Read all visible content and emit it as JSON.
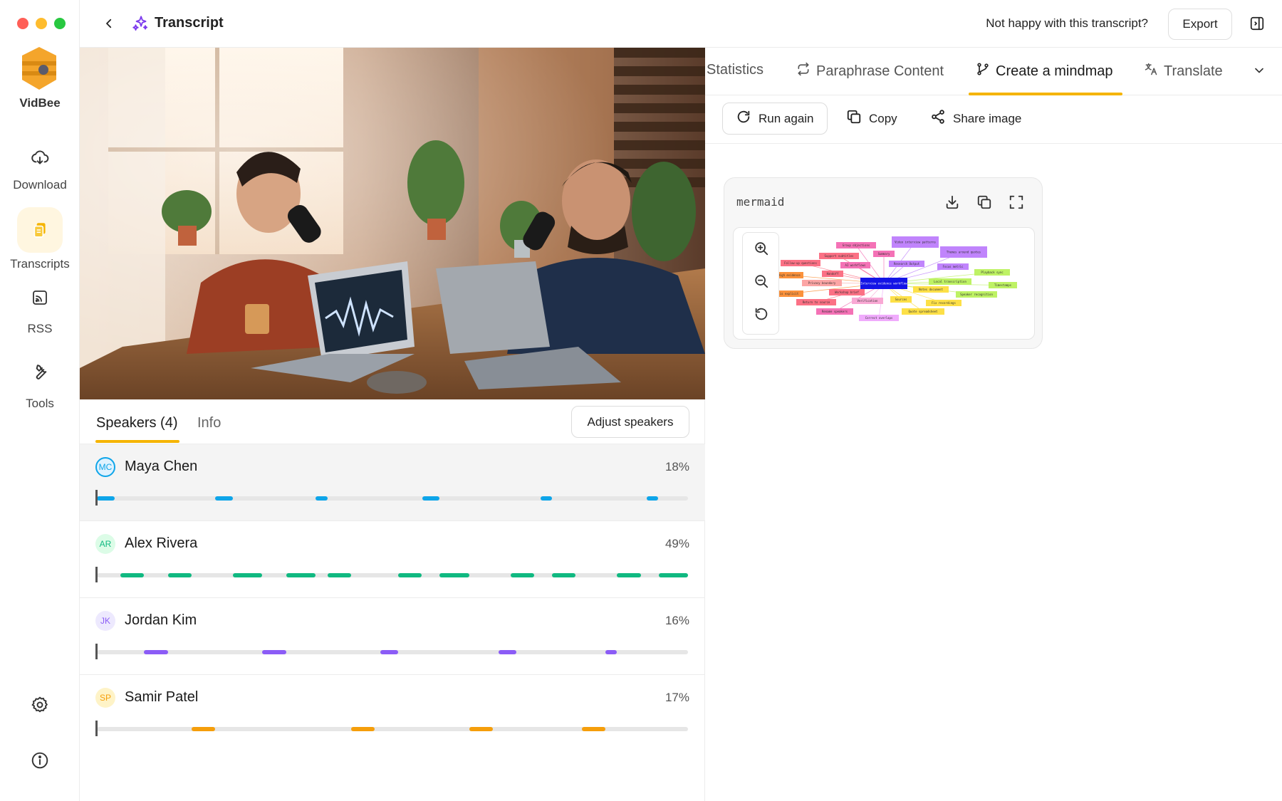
{
  "app": {
    "name": "VidBee",
    "traffic_colors": [
      "#ff5f57",
      "#febc2e",
      "#28c840"
    ]
  },
  "sidebar": {
    "items": [
      {
        "label": "Download",
        "icon": "cloud-download-icon"
      },
      {
        "label": "Transcripts",
        "icon": "document-copy-icon",
        "active": true
      },
      {
        "label": "RSS",
        "icon": "rss-icon"
      },
      {
        "label": "Tools",
        "icon": "wrench-icon"
      }
    ],
    "bottom": [
      {
        "icon": "gear-icon"
      },
      {
        "icon": "info-icon"
      }
    ]
  },
  "header": {
    "title": "Transcript",
    "feedback_text": "Not happy with this transcript?",
    "export_label": "Export"
  },
  "speakers_panel": {
    "tabs": [
      {
        "label": "Speakers (4)",
        "active": true
      },
      {
        "label": "Info",
        "active": false
      }
    ],
    "adjust_label": "Adjust speakers",
    "speakers": [
      {
        "initials": "MC",
        "name": "Maya Chen",
        "percent": "18%",
        "color": "#0ea5e9",
        "bg": "#e0f2fe",
        "selected": true,
        "segments": [
          [
            0.0,
            0.03
          ],
          [
            0.2,
            0.23
          ],
          [
            0.37,
            0.39
          ],
          [
            0.55,
            0.58
          ],
          [
            0.75,
            0.77
          ],
          [
            0.93,
            0.95
          ]
        ]
      },
      {
        "initials": "AR",
        "name": "Alex Rivera",
        "percent": "49%",
        "color": "#10b981",
        "bg": "#dcfce7",
        "selected": false,
        "segments": [
          [
            0.04,
            0.08
          ],
          [
            0.12,
            0.16
          ],
          [
            0.23,
            0.28
          ],
          [
            0.32,
            0.37
          ],
          [
            0.39,
            0.43
          ],
          [
            0.51,
            0.55
          ],
          [
            0.58,
            0.63
          ],
          [
            0.7,
            0.74
          ],
          [
            0.77,
            0.81
          ],
          [
            0.88,
            0.92
          ],
          [
            0.95,
            1.0
          ]
        ]
      },
      {
        "initials": "JK",
        "name": "Jordan Kim",
        "percent": "16%",
        "color": "#8b5cf6",
        "bg": "#ede9fe",
        "selected": false,
        "segments": [
          [
            0.08,
            0.12
          ],
          [
            0.28,
            0.32
          ],
          [
            0.48,
            0.51
          ],
          [
            0.68,
            0.71
          ],
          [
            0.86,
            0.88
          ]
        ]
      },
      {
        "initials": "SP",
        "name": "Samir Patel",
        "percent": "17%",
        "color": "#f59e0b",
        "bg": "#fef3c7",
        "selected": false,
        "segments": [
          [
            0.16,
            0.2
          ],
          [
            0.43,
            0.47
          ],
          [
            0.63,
            0.67
          ],
          [
            0.82,
            0.86
          ]
        ]
      }
    ]
  },
  "right_panel": {
    "tabs": [
      {
        "label": "Statistics",
        "icon": "",
        "active": false
      },
      {
        "label": "Paraphrase Content",
        "icon": "repeat-icon",
        "active": false
      },
      {
        "label": "Create a mindmap",
        "icon": "branch-icon",
        "active": true
      },
      {
        "label": "Translate",
        "icon": "translate-icon",
        "active": false
      }
    ],
    "actions": [
      {
        "label": "Run again",
        "icon": "refresh-icon"
      },
      {
        "label": "Copy",
        "icon": "copy-icon"
      },
      {
        "label": "Share image",
        "icon": "share-icon"
      }
    ],
    "mermaid": {
      "label": "mermaid",
      "nodes": [
        {
          "text": "Interview evidence workflow",
          "color": "#1414e6"
        },
        {
          "text": "Group objections",
          "color": "#f472b6"
        },
        {
          "text": "Video interview patterns",
          "color": "#c084fc"
        },
        {
          "text": "Support subtitles",
          "color": "#fb7185"
        },
        {
          "text": "Summary",
          "color": "#f472b6"
        },
        {
          "text": "Follow-up questions",
          "color": "#fb7185"
        },
        {
          "text": "AI workflows",
          "color": "#f472b6"
        },
        {
          "text": "Research Output",
          "color": "#c084fc"
        },
        {
          "text": "Themes around quotes",
          "color": "#c084fc"
        },
        {
          "text": "Focus metric",
          "color": "#c084fc"
        },
        {
          "text": "Playback sync",
          "color": "#bef264"
        },
        {
          "text": "High evidence",
          "color": "#fb923c"
        },
        {
          "text": "Handoff",
          "color": "#fb7185"
        },
        {
          "text": "Privacy boundary",
          "color": "#fca5a5"
        },
        {
          "text": "Local transcription",
          "color": "#bef264"
        },
        {
          "text": "Timestamps",
          "color": "#bef264"
        },
        {
          "text": "Notes document",
          "color": "#fde047"
        },
        {
          "text": "Speaker recognition",
          "color": "#bef264"
        },
        {
          "text": "Workshop brief",
          "color": "#fb7185"
        },
        {
          "text": "is explicit",
          "color": "#fb923c"
        },
        {
          "text": "Sources",
          "color": "#fde047"
        },
        {
          "text": "Return to source",
          "color": "#fb7185"
        },
        {
          "text": "Verification",
          "color": "#f9a8d4"
        },
        {
          "text": "Fix recordings",
          "color": "#fde047"
        },
        {
          "text": "Rename speakers",
          "color": "#f472b6"
        },
        {
          "text": "Quote spreadsheet",
          "color": "#fde047"
        },
        {
          "text": "Correct overlaps",
          "color": "#f0abfc"
        }
      ]
    }
  }
}
